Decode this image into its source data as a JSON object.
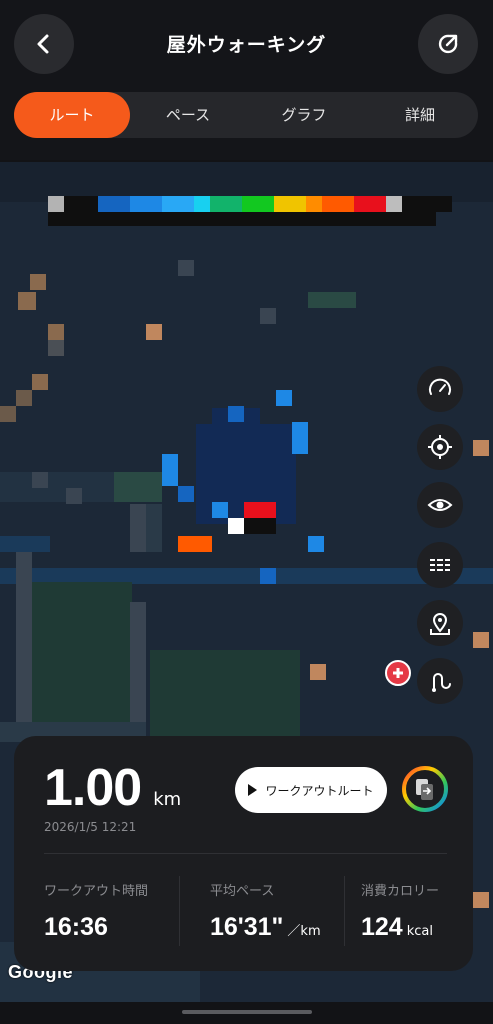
{
  "header": {
    "title": "屋外ウォーキング",
    "back_icon": "chevron-left-icon",
    "share_icon": "share-icon"
  },
  "tabs": [
    {
      "label": "ルート",
      "active": true
    },
    {
      "label": "ペース",
      "active": false
    },
    {
      "label": "グラフ",
      "active": false
    },
    {
      "label": "詳細",
      "active": false
    }
  ],
  "map": {
    "legend_colors": [
      "#b3b3b3",
      "#0f0f0f",
      "#1565c0",
      "#1e88e5",
      "#29a8f5",
      "#18d0f0",
      "#12b36b",
      "#12c820",
      "#f0c400",
      "#ff8c00",
      "#ff5a00",
      "#e8101c",
      "#bdbdbd",
      "#0f0f0f"
    ],
    "controls": [
      "speedometer-icon",
      "locate-icon",
      "eye-icon",
      "layers-icon",
      "map-pin-icon",
      "route-icon"
    ],
    "attribution": "Google"
  },
  "summary": {
    "distance": "1.00",
    "distance_unit": "km",
    "datetime": "2026/1/5 12:21",
    "route_button_label": "ワークアウトルート",
    "stats": [
      {
        "label": "ワークアウト時間",
        "value": "16:36",
        "unit": ""
      },
      {
        "label": "平均ペース",
        "value": "16'31\"",
        "unit": "／km"
      },
      {
        "label": "消費カロリー",
        "value": "124",
        "unit": "kcal"
      }
    ]
  }
}
